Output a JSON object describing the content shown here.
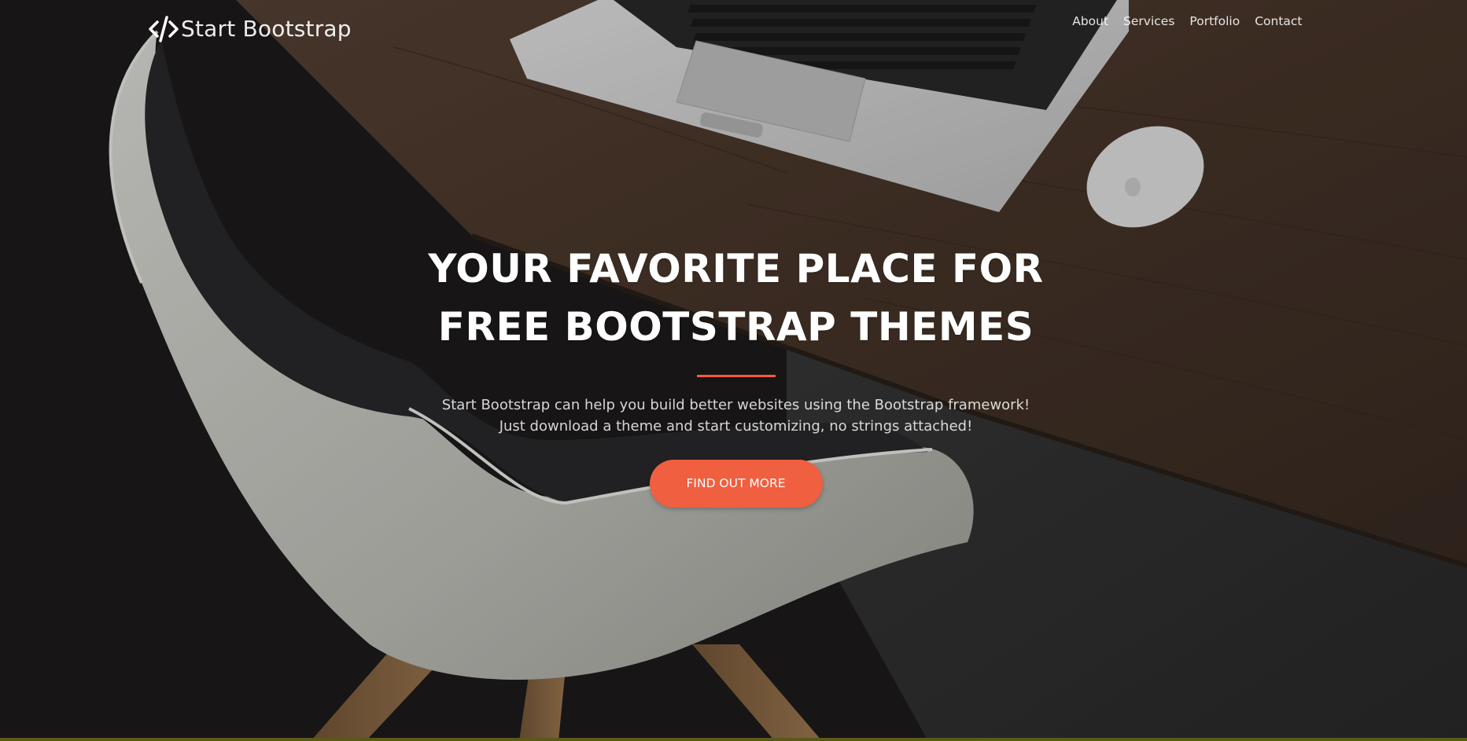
{
  "navbar": {
    "brand": {
      "icon": "code-icon",
      "label": "Start Bootstrap"
    },
    "links": [
      {
        "label": "About"
      },
      {
        "label": "Services"
      },
      {
        "label": "Portfolio"
      },
      {
        "label": "Contact"
      }
    ]
  },
  "hero": {
    "title": "YOUR FAVORITE PLACE FOR FREE BOOTSTRAP THEMES",
    "text": "Start Bootstrap can help you build better websites using the Bootstrap framework! Just download a theme and start customizing, no strings attached!",
    "button_label": "FIND OUT MORE"
  },
  "colors": {
    "accent": "#f05f40",
    "text": "#ffffff",
    "background": "#1f1d1c"
  }
}
